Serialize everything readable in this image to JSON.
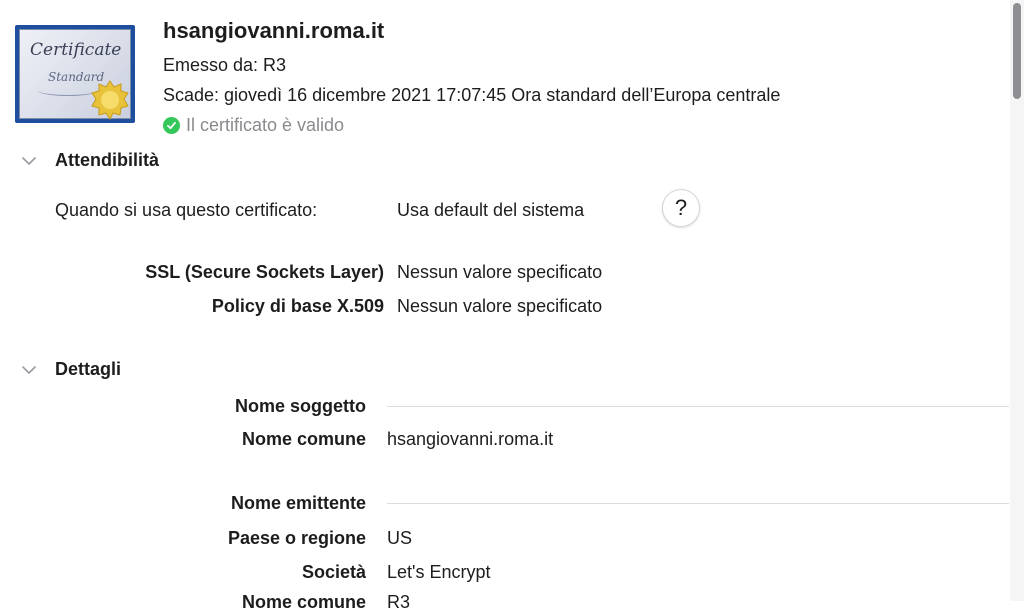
{
  "header": {
    "cert_icon": {
      "title": "Certificate",
      "subtitle": "Standard"
    },
    "hostname": "hsangiovanni.roma.it",
    "issued_by": "Emesso da: R3",
    "expires": "Scade: giovedì 16 dicembre 2021 17:07:45 Ora standard dell’Europa centrale",
    "status": "Il certificato è valido",
    "status_icon": "checkmark-circle-icon",
    "status_color": "#34c759"
  },
  "trust": {
    "title": "Attendibilità",
    "when_label": "Quando si usa questo certificato:",
    "when_value": "Usa default del sistema",
    "help_label": "?",
    "rows": [
      {
        "label": "SSL (Secure Sockets Layer)",
        "value": "Nessun valore specificato"
      },
      {
        "label": "Policy di base X.509",
        "value": "Nessun valore specificato"
      }
    ]
  },
  "details": {
    "title": "Dettagli",
    "subject_heading": "Nome soggetto",
    "subject_rows": [
      {
        "label": "Nome comune",
        "value": "hsangiovanni.roma.it"
      }
    ],
    "issuer_heading": "Nome emittente",
    "issuer_rows": [
      {
        "label": "Paese o regione",
        "value": "US"
      },
      {
        "label": "Società",
        "value": "Let's Encrypt"
      },
      {
        "label": "Nome comune",
        "value": "R3"
      }
    ]
  }
}
